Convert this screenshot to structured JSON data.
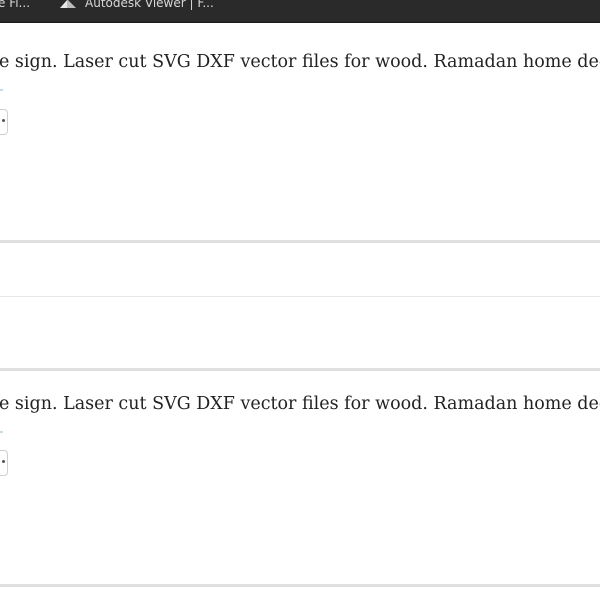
{
  "bookmarks_bar": {
    "items": [
      {
        "label": "e Fi..."
      },
      {
        "label": "Autodesk Viewer | F...",
        "icon": "autodesk-icon"
      }
    ]
  },
  "listings": [
    {
      "title": "e sign. Laser cut SVG DXF vector files for wood. Ramadan home decor"
    },
    {
      "title": "e sign. Laser cut SVG DXF vector files for wood. Ramadan home decor"
    }
  ],
  "colors": {
    "topbar": "#2a2a2a",
    "text": "#222222",
    "separator": "#e0e0e0",
    "background": "#ffffff"
  }
}
